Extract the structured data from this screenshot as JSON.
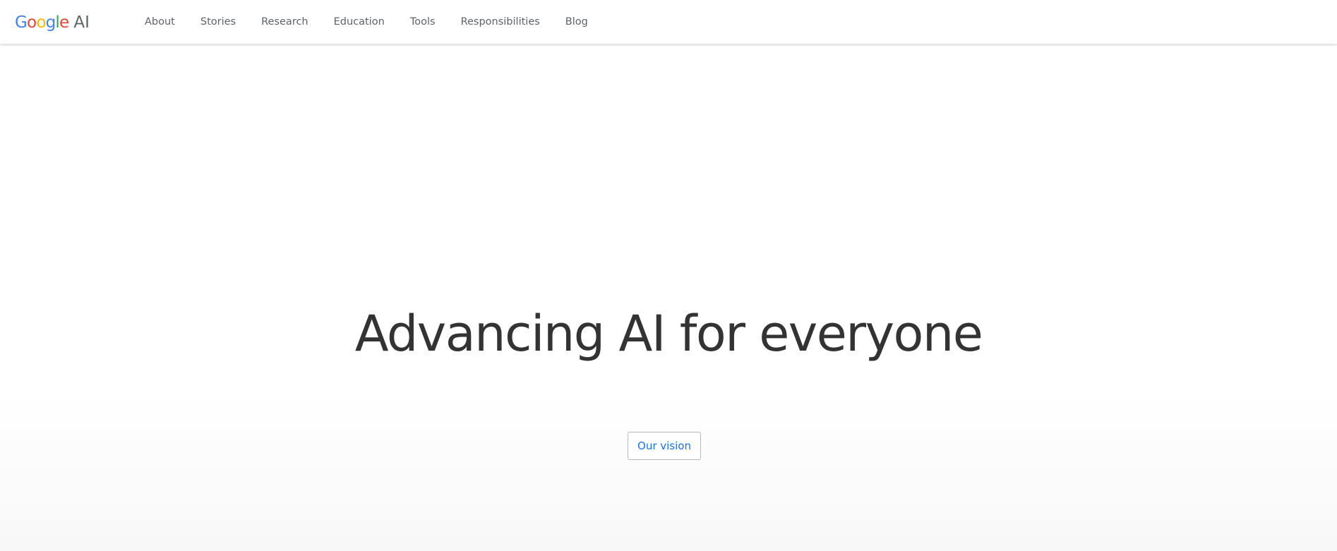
{
  "brand": {
    "logo_letters": [
      {
        "char": "G",
        "color": "#4285F4"
      },
      {
        "char": "o",
        "color": "#EA4335"
      },
      {
        "char": "o",
        "color": "#FBBC05"
      },
      {
        "char": "g",
        "color": "#4285F4"
      },
      {
        "char": "l",
        "color": "#34A853"
      },
      {
        "char": "e",
        "color": "#EA4335"
      }
    ],
    "logo_suffix": "AI"
  },
  "nav": {
    "items": [
      {
        "label": "About"
      },
      {
        "label": "Stories"
      },
      {
        "label": "Research"
      },
      {
        "label": "Education"
      },
      {
        "label": "Tools"
      },
      {
        "label": "Responsibilities"
      },
      {
        "label": "Blog"
      }
    ]
  },
  "hero": {
    "title": "Advancing AI for everyone",
    "button_label": "Our vision"
  },
  "colors": {
    "text_primary": "#333333",
    "nav_text": "#5f6368",
    "link_blue": "#1a73e8"
  }
}
